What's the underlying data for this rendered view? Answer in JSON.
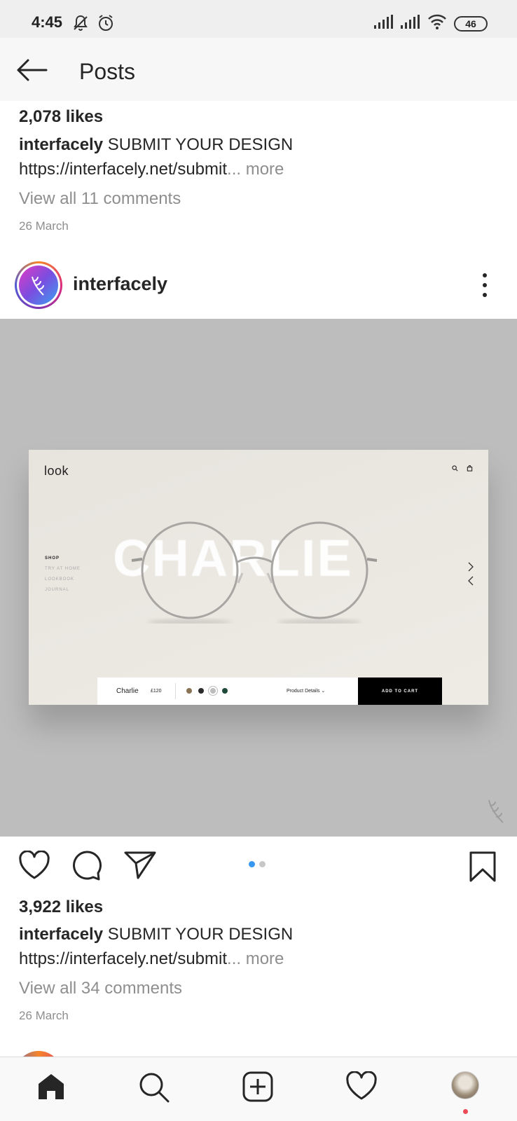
{
  "status_bar": {
    "time": "4:45",
    "battery": "46",
    "icons": [
      "mute-icon",
      "alarm-icon",
      "signal-icon",
      "signal-icon",
      "wifi-icon"
    ]
  },
  "header": {
    "title": "Posts",
    "back_icon": "arrow-left-icon"
  },
  "previous_post": {
    "likes": "2,078 likes",
    "username": "interfacely",
    "caption": "SUBMIT YOUR DESIGN",
    "link": "https://interfacely.net/submit",
    "more": "... more",
    "comments": "View all 11 comments",
    "date": "26 March"
  },
  "post": {
    "username": "interfacely",
    "media": {
      "logo": "look",
      "nav": [
        "SHOP",
        "TRY AT HOME",
        "LOOKBOOK",
        "JOURNAL"
      ],
      "hero_text": "CHARLIE",
      "product_name": "Charlie",
      "price": "£120",
      "details": "Product Details",
      "cart_label": "ADD TO CART",
      "swatch_colors": [
        "#8a7354",
        "#2b2b2b",
        "#bdbdbd",
        "#1f4a3a"
      ],
      "carousel_index": 1,
      "carousel_count": 2
    },
    "likes": "3,922 likes",
    "caption_user": "interfacely",
    "caption": "SUBMIT YOUR DESIGN",
    "link": "https://interfacely.net/submit",
    "more": "... more",
    "comments": "View all 34 comments",
    "date": "26 March"
  },
  "bottom_nav": {
    "items": [
      "home-icon",
      "search-icon",
      "new-post-icon",
      "activity-icon",
      "profile-avatar"
    ]
  },
  "colors": {
    "accent_blue": "#3897f0",
    "notification_red": "#ed4956",
    "muted_text": "#8e8e8e"
  }
}
